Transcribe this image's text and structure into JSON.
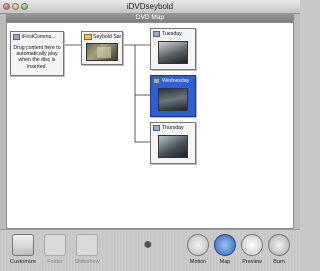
{
  "window": {
    "title": "iDVDseybold"
  },
  "view": {
    "title": "DVD Map"
  },
  "map": {
    "root": {
      "label": "iFirstCommu...",
      "message": "Drug content here to automatically play when the disc is inserted."
    },
    "menu": {
      "label": "Seybold San..."
    },
    "items": [
      {
        "label": "Tuesday"
      },
      {
        "label": "Wednesday"
      },
      {
        "label": "Thursday"
      }
    ]
  },
  "toolbar": {
    "customize": "Customize",
    "folder": "Folder",
    "slideshow": "Slideshow",
    "motion": "Motion",
    "map": "Map",
    "preview": "Preview",
    "burn": "Burn"
  }
}
